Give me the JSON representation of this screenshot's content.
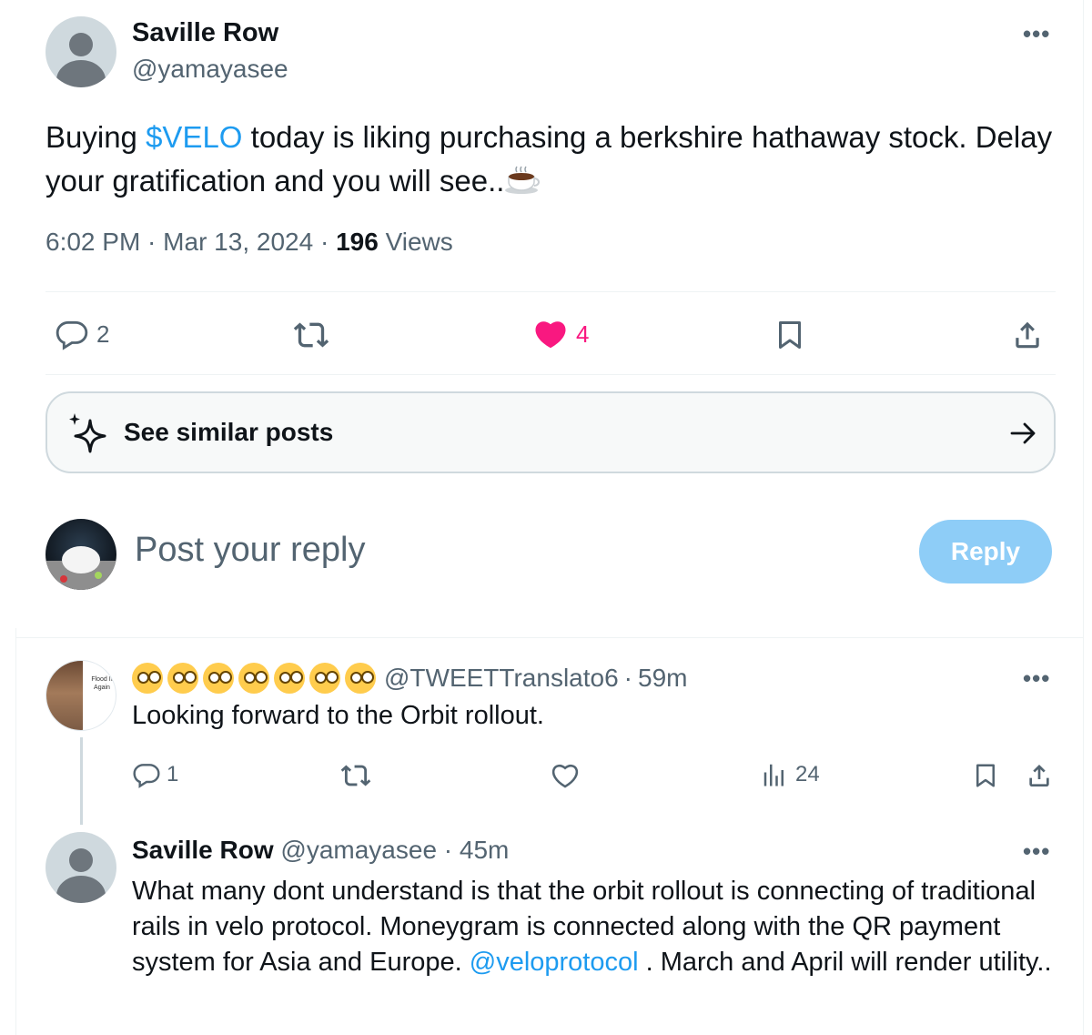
{
  "tweet": {
    "author_name": "Saville Row",
    "author_handle": "@yamayasee",
    "text_before": "Buying ",
    "cashtag": "$VELO",
    "text_after": " today is liking purchasing a berkshire hathaway stock. Delay your gratification and you will see..",
    "emoji": "hot-beverage",
    "time": "6:02 PM",
    "date": "Mar 13, 2024",
    "views_count": "196",
    "views_label": "Views",
    "replies": "2",
    "likes": "4",
    "like_color": "#f91880",
    "link_color": "#1d9bf0"
  },
  "similar": {
    "label": "See similar posts"
  },
  "compose": {
    "placeholder": "Post your reply",
    "button_label": "Reply",
    "button_color": "#8ecdf7"
  },
  "replies": [
    {
      "avatar_text": "Flood It Again",
      "display_name_emoji": "face-with-monocle x7",
      "handle": "@TWEETTranslato6",
      "time": "59m",
      "text": "Looking forward to the Orbit rollout.",
      "reply_count": "1",
      "views": "24"
    },
    {
      "author_name": "Saville Row",
      "handle": "@yamayasee",
      "time": "45m",
      "text_before": "What many dont understand is that the orbit rollout is connecting of traditional rails in velo protocol. Moneygram is connected along with the QR payment system for Asia and Europe. ",
      "mention": "@veloprotocol",
      "text_after": " . March and April will render utility.."
    }
  ]
}
